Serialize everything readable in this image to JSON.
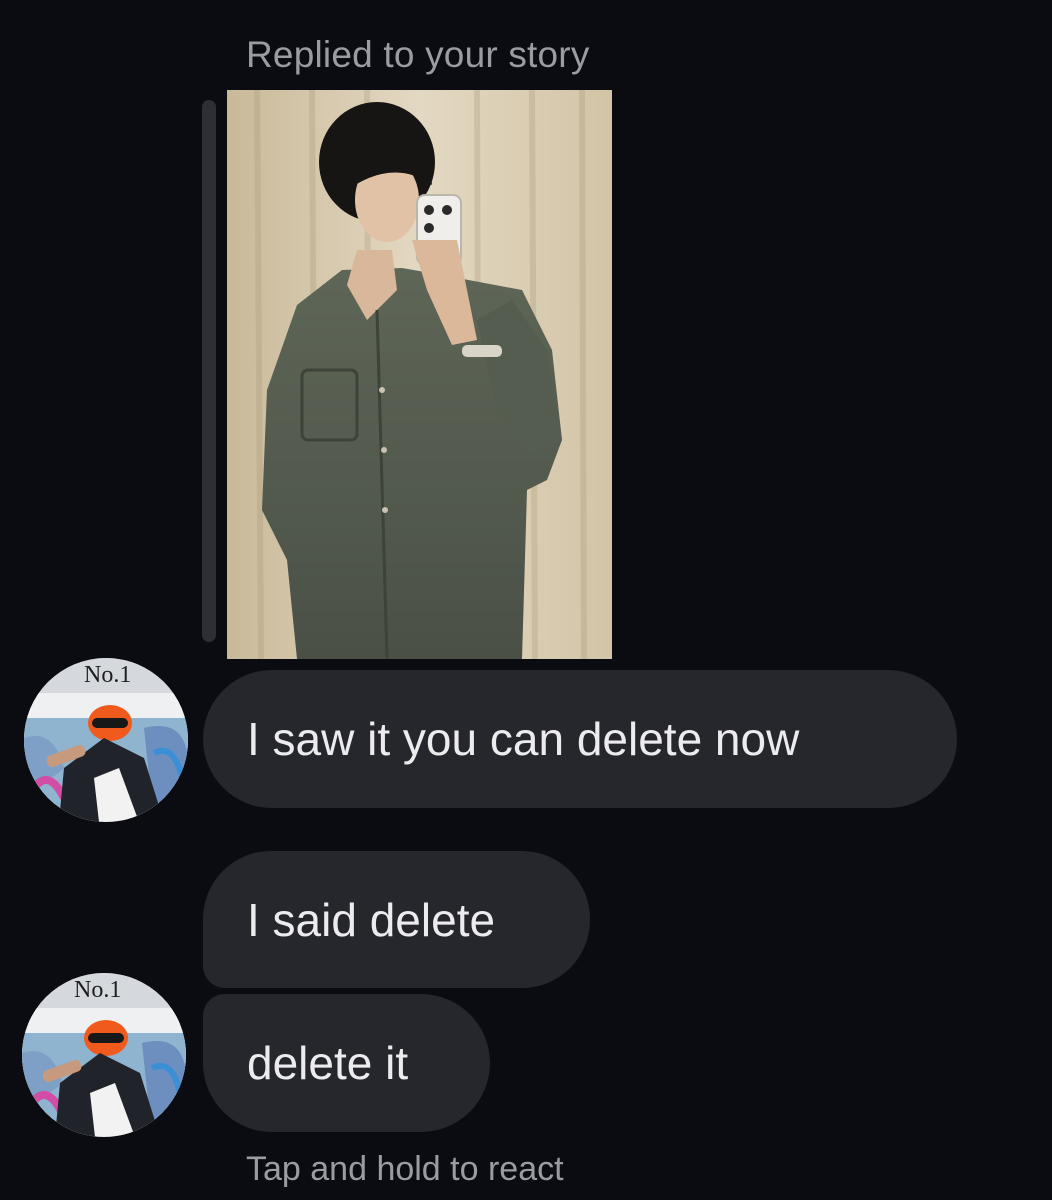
{
  "thread": {
    "reply_caption": "Replied to your story",
    "messages": [
      {
        "text": "I saw it you can delete now"
      },
      {
        "text": "I said delete"
      },
      {
        "text": "delete it"
      }
    ],
    "react_hint": "Tap and hold to react"
  },
  "avatar": {
    "sign_text": "No.1"
  },
  "colors": {
    "background": "#0b0c12",
    "bubble": "#26272d",
    "text": "#ececee",
    "muted_text": "#9a9ca4"
  }
}
